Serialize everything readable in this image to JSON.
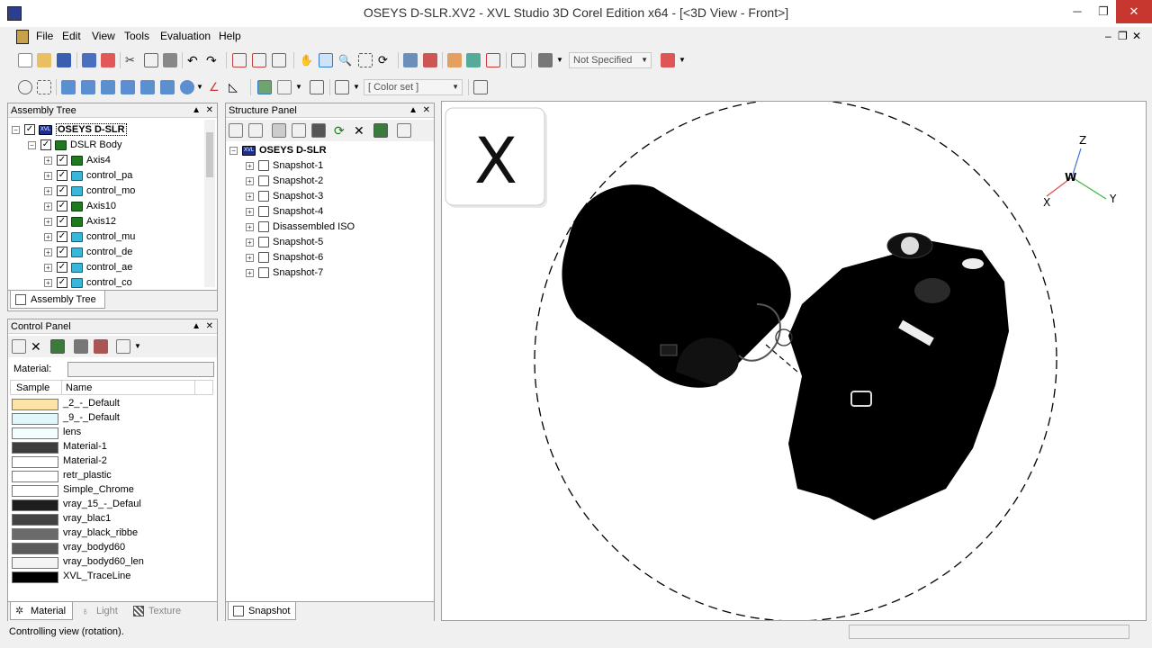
{
  "window": {
    "title": "OSEYS D-SLR.XV2 - XVL Studio 3D Corel Edition x64 - [<3D View - Front>]",
    "minimize": "─",
    "maximize": "❐",
    "close": "✕"
  },
  "menu": {
    "items": [
      "File",
      "Edit",
      "View",
      "Tools",
      "Evaluation",
      "Help"
    ],
    "mdi_min": "–",
    "mdi_restore": "❐",
    "mdi_close": "✕"
  },
  "toolbar": {
    "select_filter": "Not Specified",
    "color_set": "[ Color set ]"
  },
  "assembly_tree": {
    "header": "Assembly Tree",
    "tab_label": "Assembly Tree",
    "root": "OSEYS D-SLR",
    "body": "DSLR Body",
    "items": [
      {
        "label": "Axis4",
        "icon": "green"
      },
      {
        "label": "control_pa",
        "icon": "cyan"
      },
      {
        "label": "control_mo",
        "icon": "cyan"
      },
      {
        "label": "Axis10",
        "icon": "green"
      },
      {
        "label": "Axis12",
        "icon": "green"
      },
      {
        "label": "control_mu",
        "icon": "cyan"
      },
      {
        "label": "control_de",
        "icon": "cyan"
      },
      {
        "label": "control_ae",
        "icon": "cyan"
      },
      {
        "label": "control_co",
        "icon": "cyan"
      }
    ]
  },
  "structure_panel": {
    "header": "Structure Panel",
    "root": "OSEYS D-SLR",
    "items": [
      "Snapshot-1",
      "Snapshot-2",
      "Snapshot-3",
      "Snapshot-4",
      "Disassembled ISO",
      "Snapshot-5",
      "Snapshot-6",
      "Snapshot-7"
    ],
    "tab_label": "Snapshot"
  },
  "control_panel": {
    "header": "Control Panel",
    "material_label": "Material:",
    "col_sample": "Sample",
    "col_name": "Name",
    "materials": [
      {
        "name": "_2_-_Default",
        "color": "#fde3a6"
      },
      {
        "name": "_9_-_Default",
        "color": "#dff7fb"
      },
      {
        "name": "lens",
        "color": "#f4fdfd"
      },
      {
        "name": "Material-1",
        "color": "#3d3d3d"
      },
      {
        "name": "Material-2",
        "color": "#ffffff"
      },
      {
        "name": "retr_plastic",
        "color": "#ffffff"
      },
      {
        "name": "Simple_Chrome",
        "color": "#ffffff"
      },
      {
        "name": "vray_15_-_Defaul",
        "color": "#1e1e1e"
      },
      {
        "name": "vray_blac1",
        "color": "#434343"
      },
      {
        "name": "vray_black_ribbe",
        "color": "#6b6b6b"
      },
      {
        "name": "vray_bodyd60",
        "color": "#5b5b5b"
      },
      {
        "name": "vray_bodyd60_len",
        "color": "#f4f4f4"
      },
      {
        "name": "XVL_TraceLine",
        "color": "#000000"
      }
    ],
    "tabs": [
      "Material",
      "Light",
      "Texture"
    ]
  },
  "viewport": {
    "cube_face": "X",
    "axis_z": "Z",
    "axis_x": "X",
    "axis_y": "Y",
    "axis_w": "W"
  },
  "status": {
    "text": "Controlling view (rotation)."
  }
}
